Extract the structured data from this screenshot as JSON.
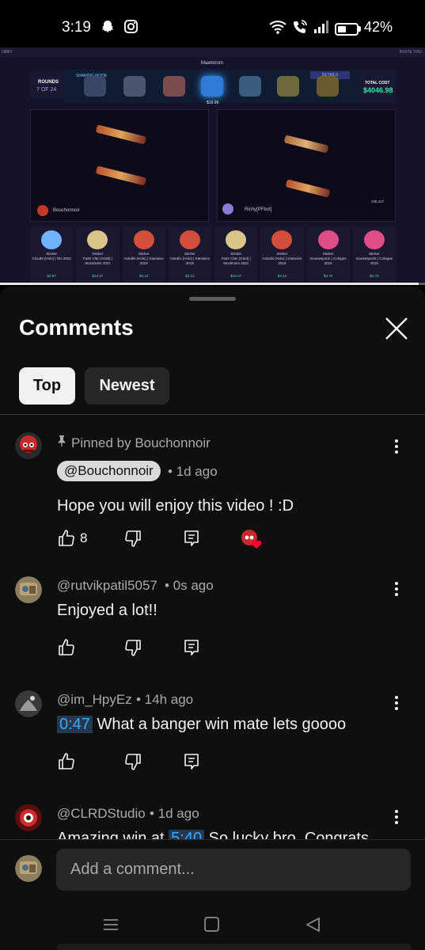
{
  "status_bar": {
    "time": "3:19",
    "battery": "42%",
    "icons": [
      "snapchat-icon",
      "instagram-icon",
      "wifi-icon",
      "wifi-call-icon",
      "signal-icon",
      "battery-icon"
    ]
  },
  "video": {
    "top_left": "OBBY",
    "top_right": "INVITE YOU",
    "case_title": "Maelstrom",
    "rounds_label": "ROUNDS",
    "rounds_value": "7 OF 24",
    "sharing_mode": "SHARING MODE",
    "details": "DETAILS",
    "mid_price": "$19.99",
    "total_label": "TOTAL COST",
    "total_value": "$4046.98",
    "player_left": "Bouchonnoir",
    "player_right": "Richy[PFbot]",
    "right_panel_value": "236,237",
    "progress": 0.985,
    "items": [
      {
        "type": "Sticker",
        "name": "Cloud9 (Holo) | Rio 2022",
        "price": "$3.97",
        "color": "#6fb4ff"
      },
      {
        "type": "Sticker",
        "name": "FaZe Clan (Gold) | Stockholm 2021",
        "price": "$13.37",
        "color": "#d9c48a"
      },
      {
        "type": "Sticker",
        "name": "Astralis (Holo) | Katowice 2019",
        "price": "$3.12",
        "color": "#d24f3c"
      },
      {
        "type": "Sticker",
        "name": "Astralis (Holo) | Katowice 2019",
        "price": "$3.12",
        "color": "#d24f3c"
      },
      {
        "type": "Sticker",
        "name": "FaZe Clan (Gold) | Stockholm 2021",
        "price": "$13.37",
        "color": "#d9c48a"
      },
      {
        "type": "Sticker",
        "name": "Astralis (Holo) | Katowice 2019",
        "price": "$3.12",
        "color": "#d24f3c"
      },
      {
        "type": "Sticker",
        "name": "mousesports | Cologne 2015",
        "price": "$4.70",
        "color": "#e04e86"
      },
      {
        "type": "Sticker",
        "name": "mousesports | Cologne 2015",
        "price": "$4.70",
        "color": "#e04e86"
      }
    ]
  },
  "sheet": {
    "title": "Comments",
    "filters": {
      "top": "Top",
      "newest": "Newest"
    }
  },
  "comments": [
    {
      "pinned_label": "Pinned by Bouchonnoir",
      "author": "@Bouchonnoir",
      "meta": "• 1d ago",
      "text": "Hope you will enjoy this video ! :D",
      "likes": "8"
    },
    {
      "author": "@rutvikpatil5057",
      "meta": "• 0s ago",
      "text": "Enjoyed a lot!!"
    },
    {
      "author": "@im_HpyEz",
      "meta": "• 14h ago",
      "timestamp": "0:47",
      "text": " What a banger win mate lets goooo"
    },
    {
      "author": "@CLRDStudio",
      "meta": "• 1d ago",
      "text_before": "Amazing win at ",
      "timestamp": "5:40",
      "text_after": " So lucky bro. Congrats"
    }
  ],
  "composer": {
    "placeholder": "Add a comment..."
  },
  "colors": {
    "background": "#0f0f0f",
    "chip_active": "#f1f1f1",
    "chip_inactive": "#272727",
    "timestamp_link": "#3ea6ff",
    "heart": "#ff0033",
    "accent_green": "#43e3a6"
  }
}
